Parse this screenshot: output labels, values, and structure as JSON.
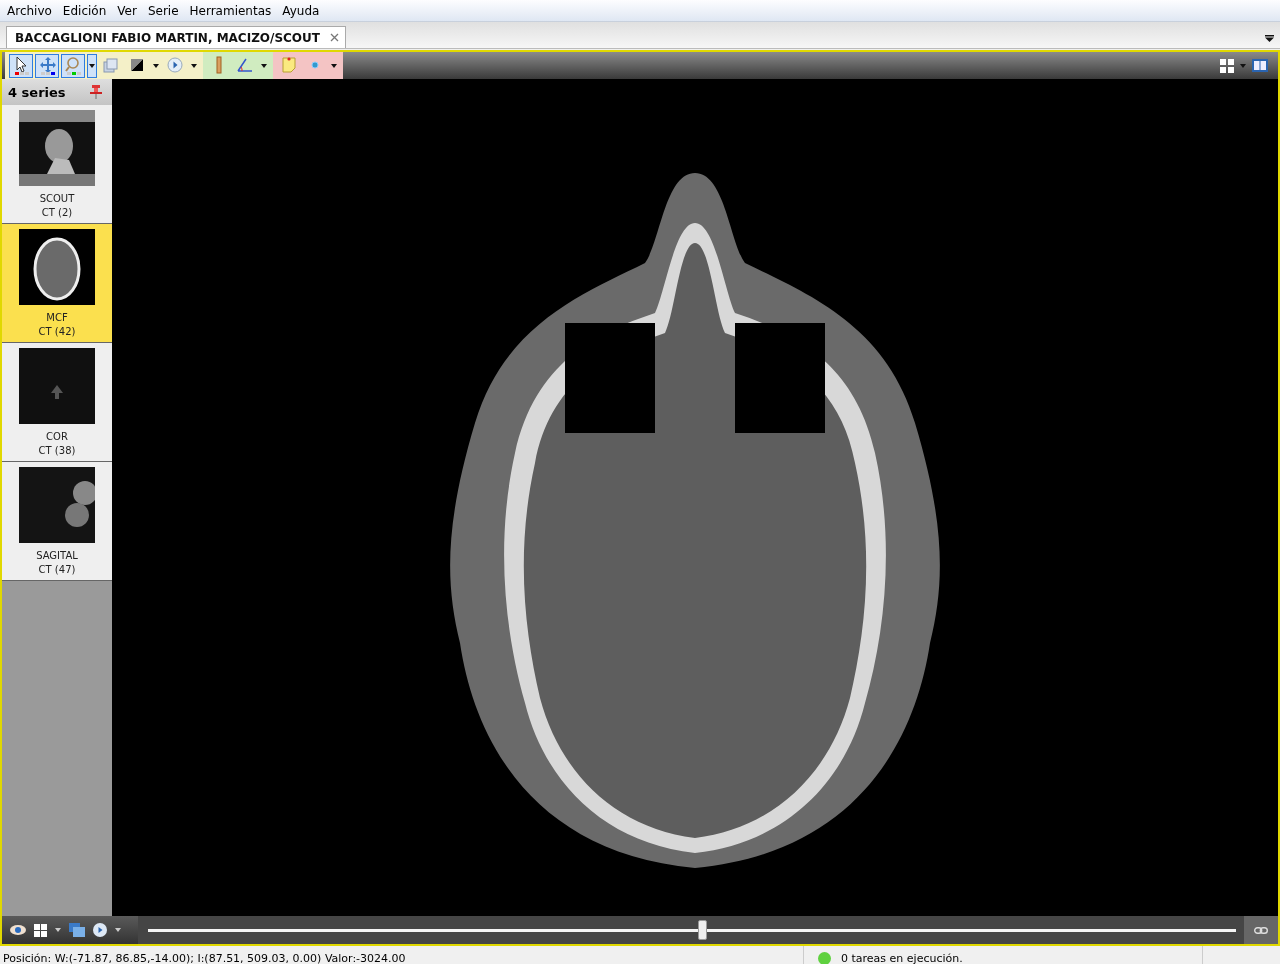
{
  "menu": [
    "Archivo",
    "Edición",
    "Ver",
    "Serie",
    "Herramientas",
    "Ayuda"
  ],
  "tabs": [
    {
      "label": "BACCAGLIONI FABIO MARTIN, MACIZO/SCOUT",
      "selected": true
    }
  ],
  "toolbar": [
    {
      "color": "#f4f0c8",
      "tools": [
        {
          "kind": "select",
          "selected": true
        },
        {
          "kind": "pan",
          "selected": true
        },
        {
          "kind": "zoom",
          "selected": true
        },
        {
          "kind": "caret",
          "selected": true
        },
        {
          "kind": "layers",
          "selected": false
        },
        {
          "kind": "contrast",
          "selected": false
        },
        {
          "kind": "caret",
          "selected": false
        },
        {
          "kind": "play",
          "selected": false
        },
        {
          "kind": "caret",
          "selected": false
        }
      ]
    },
    {
      "color": "#d0ecc0",
      "tools": [
        {
          "kind": "ruler",
          "selected": false
        },
        {
          "kind": "angle",
          "selected": false
        },
        {
          "kind": "caret",
          "selected": false
        }
      ]
    },
    {
      "color": "#f4c4c4",
      "tools": [
        {
          "kind": "note",
          "selected": false
        },
        {
          "kind": "dot",
          "selected": false
        },
        {
          "kind": "caret",
          "selected": false
        }
      ]
    }
  ],
  "series_panel": {
    "title": "4 series",
    "items": [
      {
        "name": "SCOUT",
        "count": "CT (2)",
        "kind": "scout",
        "selected": false
      },
      {
        "name": "MCF",
        "count": "CT (42)",
        "kind": "axial",
        "selected": true
      },
      {
        "name": "COR",
        "count": "CT (38)",
        "kind": "coronal",
        "selected": false
      },
      {
        "name": "SAGITAL",
        "count": "CT (47)",
        "kind": "sagittal",
        "selected": false
      }
    ]
  },
  "slider": {
    "level": 0.51
  },
  "status_bar": [
    {
      "text": "Posición: W:(-71.87, 86.85,-14.00); I:(87.51, 509.03, 0.00) Valor:-3024.00"
    },
    {
      "text": "0 tareas en ejecución.",
      "color": "#5fd13f"
    }
  ]
}
